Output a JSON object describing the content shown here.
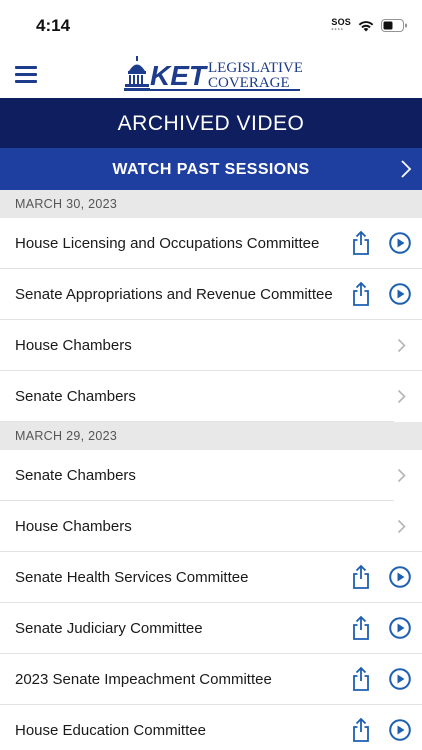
{
  "status_bar": {
    "time": "4:14",
    "sos": "SOS"
  },
  "header": {
    "logo_text_top": "LEGISLATIVE",
    "logo_text_bottom": "COVERAGE",
    "logo_brand": "KET"
  },
  "archived": {
    "title": "ARCHIVED VIDEO"
  },
  "watch": {
    "label": "WATCH PAST SESSIONS"
  },
  "colors": {
    "navy": "#0e1e5e",
    "blue": "#1f3fa0",
    "icon_blue": "#1d5fb0"
  },
  "sections": [
    {
      "date": "MARCH 30, 2023",
      "items": [
        {
          "title": "House Licensing and Occupations Committee",
          "type": "video"
        },
        {
          "title": "Senate Appropriations and Revenue Committee",
          "type": "video"
        },
        {
          "title": "House Chambers",
          "type": "nav"
        },
        {
          "title": "Senate Chambers",
          "type": "nav"
        }
      ]
    },
    {
      "date": "MARCH 29, 2023",
      "items": [
        {
          "title": "Senate Chambers",
          "type": "nav"
        },
        {
          "title": "House Chambers",
          "type": "nav"
        },
        {
          "title": "Senate Health Services Committee",
          "type": "video"
        },
        {
          "title": "Senate Judiciary Committee",
          "type": "video"
        },
        {
          "title": "2023 Senate Impeachment Committee",
          "type": "video"
        },
        {
          "title": "House Education Committee",
          "type": "video"
        }
      ]
    }
  ]
}
